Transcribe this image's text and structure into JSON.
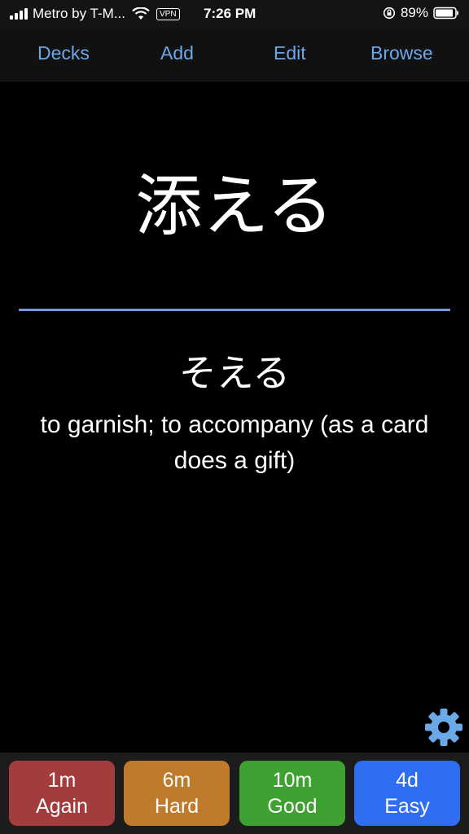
{
  "status_bar": {
    "carrier": "Metro by T-M...",
    "vpn": "VPN",
    "time": "7:26 PM",
    "battery": "89%"
  },
  "toolbar": {
    "decks": "Decks",
    "add": "Add",
    "edit": "Edit",
    "browse": "Browse"
  },
  "card": {
    "front": "添える",
    "reading": "そえる",
    "meaning": "to garnish; to accompany (as a card does a gift)"
  },
  "answers": [
    {
      "interval": "1m",
      "label": "Again",
      "color": "#a33d3d"
    },
    {
      "interval": "6m",
      "label": "Hard",
      "color": "#c07a2c"
    },
    {
      "interval": "10m",
      "label": "Good",
      "color": "#3ea132"
    },
    {
      "interval": "4d",
      "label": "Easy",
      "color": "#2f6df2"
    }
  ],
  "colors": {
    "accent": "#6aa8e8",
    "divider": "#7a98e0",
    "background": "#000000"
  }
}
